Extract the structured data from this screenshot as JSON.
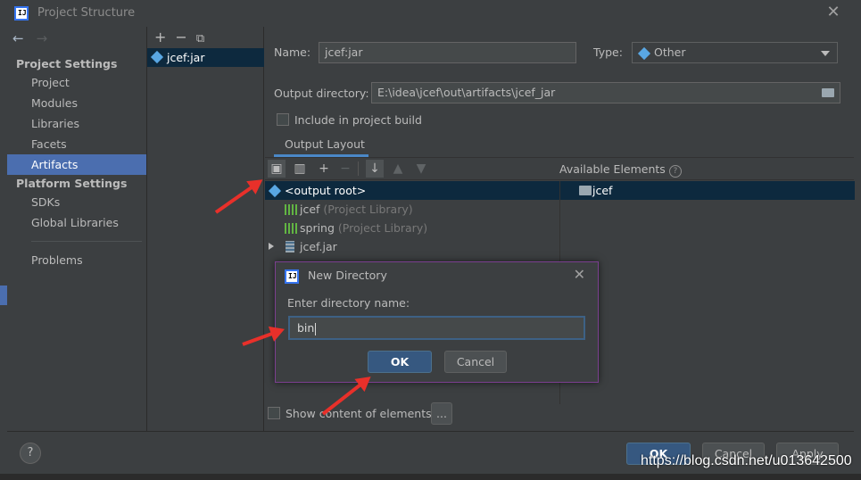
{
  "window": {
    "title": "Project Structure"
  },
  "nav": {
    "project_settings_header": "Project Settings",
    "project_settings_items": [
      "Project",
      "Modules",
      "Libraries",
      "Facets",
      "Artifacts"
    ],
    "selected_item": "Artifacts",
    "platform_settings_header": "Platform Settings",
    "platform_settings_items": [
      "SDKs",
      "Global Libraries"
    ],
    "problems": "Problems"
  },
  "artifacts_list": {
    "items": [
      "jcef:jar"
    ]
  },
  "form": {
    "name_label": "Name:",
    "name_value": "jcef:jar",
    "type_label": "Type:",
    "type_value": "Other",
    "output_dir_label": "Output directory:",
    "output_dir_value": "E:\\idea\\jcef\\out\\artifacts\\jcef_jar",
    "include_build_label": "Include in project build",
    "include_build_checked": false,
    "tab_label": "Output Layout",
    "available_elements_label": "Available Elements",
    "show_content_label": "Show content of elements",
    "show_content_checked": false,
    "ellipsis_label": "..."
  },
  "layout_tree": [
    {
      "label": "<output root>",
      "suffix": ""
    },
    {
      "label": "jcef",
      "suffix": " (Project Library)"
    },
    {
      "label": "spring",
      "suffix": " (Project Library)"
    },
    {
      "label": "jcef.jar",
      "suffix": ""
    }
  ],
  "available_elements": [
    "jcef"
  ],
  "dialog": {
    "title": "New Directory",
    "prompt": "Enter directory name:",
    "input_value": "bin",
    "ok_label": "OK",
    "cancel_label": "Cancel"
  },
  "footer": {
    "help_label": "?",
    "ok_label": "OK",
    "cancel_label": "Cancel",
    "apply_label": "Apply"
  },
  "watermark": "https://blog.csdn.net/u013642500",
  "colors": {
    "selection": "#4b6eaf",
    "tree_selection": "#0d293e",
    "annotation_arrow": "#e8302a",
    "dialog_border": "#7b3f8f"
  }
}
